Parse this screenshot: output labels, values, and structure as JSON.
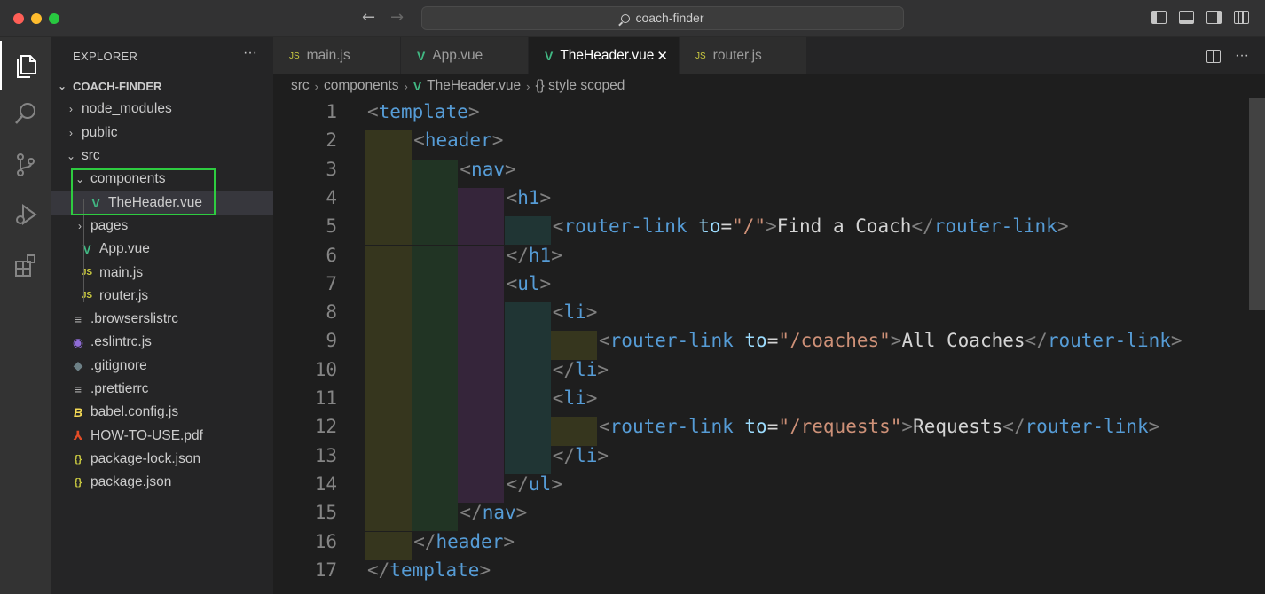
{
  "window": {
    "search_text": "coach-finder"
  },
  "sidebar": {
    "header": "EXPLORER",
    "more": "···",
    "tree": [
      {
        "label": "COACH-FINDER",
        "chevron": "⌄",
        "icon": "",
        "icon_name": "folder-root",
        "indent": 0,
        "root": true
      },
      {
        "label": "node_modules",
        "chevron": "›",
        "icon": "",
        "icon_name": "folder-collapsed",
        "indent": 1
      },
      {
        "label": "public",
        "chevron": "›",
        "icon": "",
        "icon_name": "folder-collapsed",
        "indent": 1
      },
      {
        "label": "src",
        "chevron": "⌄",
        "icon": "",
        "icon_name": "folder-expanded",
        "indent": 1
      },
      {
        "label": "components",
        "chevron": "⌄",
        "icon": "",
        "icon_name": "folder-expanded",
        "indent": 2
      },
      {
        "label": "TheHeader.vue",
        "chevron": "",
        "icon": "V",
        "icon_name": "vue-icon",
        "indent": 3,
        "selected": true
      },
      {
        "label": "pages",
        "chevron": "›",
        "icon": "",
        "icon_name": "folder-collapsed",
        "indent": 2
      },
      {
        "label": "App.vue",
        "chevron": "",
        "icon": "V",
        "icon_name": "vue-icon",
        "indent": 2
      },
      {
        "label": "main.js",
        "chevron": "",
        "icon": "JS",
        "icon_name": "js-icon",
        "indent": 2
      },
      {
        "label": "router.js",
        "chevron": "",
        "icon": "JS",
        "icon_name": "js-icon",
        "indent": 2
      },
      {
        "label": ".browserslistrc",
        "chevron": "",
        "icon": "≡",
        "icon_name": "config-icon",
        "indent": 1
      },
      {
        "label": ".eslintrc.js",
        "chevron": "",
        "icon": "◉",
        "icon_name": "eslint-icon",
        "indent": 1
      },
      {
        "label": ".gitignore",
        "chevron": "",
        "icon": "◆",
        "icon_name": "git-icon",
        "indent": 1
      },
      {
        "label": ".prettierrc",
        "chevron": "",
        "icon": "≡",
        "icon_name": "config-icon",
        "indent": 1
      },
      {
        "label": "babel.config.js",
        "chevron": "",
        "icon": "B",
        "icon_name": "babel-icon",
        "indent": 1
      },
      {
        "label": "HOW-TO-USE.pdf",
        "chevron": "",
        "icon": "⅄",
        "icon_name": "pdf-icon",
        "indent": 1
      },
      {
        "label": "package-lock.json",
        "chevron": "",
        "icon": "{}",
        "icon_name": "json-icon",
        "indent": 1
      },
      {
        "label": "package.json",
        "chevron": "",
        "icon": "{}",
        "icon_name": "json-icon",
        "indent": 1
      }
    ]
  },
  "tabs": [
    {
      "label": "main.js",
      "icon": "JS",
      "active": false
    },
    {
      "label": "App.vue",
      "icon": "V",
      "active": false
    },
    {
      "label": "TheHeader.vue",
      "icon": "V",
      "active": true,
      "close": "✕"
    },
    {
      "label": "router.js",
      "icon": "JS",
      "active": false
    }
  ],
  "breadcrumb": {
    "src": "src",
    "components": "components",
    "file": "TheHeader.vue",
    "section": "{} style scoped",
    "vue_icon": "V",
    "sep": "›"
  },
  "code": {
    "lines": [
      {
        "n": "1",
        "indent": 0,
        "tokens": [
          [
            "punc",
            "<"
          ],
          [
            "tag",
            "template"
          ],
          [
            "punc",
            ">"
          ]
        ]
      },
      {
        "n": "2",
        "indent": 1,
        "tokens": [
          [
            "punc",
            "<"
          ],
          [
            "tag",
            "header"
          ],
          [
            "punc",
            ">"
          ]
        ]
      },
      {
        "n": "3",
        "indent": 2,
        "tokens": [
          [
            "punc",
            "<"
          ],
          [
            "tag",
            "nav"
          ],
          [
            "punc",
            ">"
          ]
        ]
      },
      {
        "n": "4",
        "indent": 3,
        "tokens": [
          [
            "punc",
            "<"
          ],
          [
            "tag",
            "h1"
          ],
          [
            "punc",
            ">"
          ]
        ]
      },
      {
        "n": "5",
        "indent": 4,
        "tokens": [
          [
            "punc",
            "<"
          ],
          [
            "tag",
            "router-link"
          ],
          [
            "text",
            " "
          ],
          [
            "attr",
            "to"
          ],
          [
            "eq",
            "="
          ],
          [
            "str",
            "\"/\""
          ],
          [
            "punc",
            ">"
          ],
          [
            "text",
            "Find a Coach"
          ],
          [
            "punc",
            "</"
          ],
          [
            "tag",
            "router-link"
          ],
          [
            "punc",
            ">"
          ]
        ]
      },
      {
        "n": "6",
        "indent": 3,
        "tokens": [
          [
            "punc",
            "</"
          ],
          [
            "tag",
            "h1"
          ],
          [
            "punc",
            ">"
          ]
        ]
      },
      {
        "n": "7",
        "indent": 3,
        "tokens": [
          [
            "punc",
            "<"
          ],
          [
            "tag",
            "ul"
          ],
          [
            "punc",
            ">"
          ]
        ]
      },
      {
        "n": "8",
        "indent": 4,
        "tokens": [
          [
            "punc",
            "<"
          ],
          [
            "tag",
            "li"
          ],
          [
            "punc",
            ">"
          ]
        ]
      },
      {
        "n": "9",
        "indent": 5,
        "tokens": [
          [
            "punc",
            "<"
          ],
          [
            "tag",
            "router-link"
          ],
          [
            "text",
            " "
          ],
          [
            "attr",
            "to"
          ],
          [
            "eq",
            "="
          ],
          [
            "str",
            "\"/coaches\""
          ],
          [
            "punc",
            ">"
          ],
          [
            "text",
            "All Coaches"
          ],
          [
            "punc",
            "</"
          ],
          [
            "tag",
            "router-link"
          ],
          [
            "punc",
            ">"
          ]
        ]
      },
      {
        "n": "10",
        "indent": 4,
        "tokens": [
          [
            "punc",
            "</"
          ],
          [
            "tag",
            "li"
          ],
          [
            "punc",
            ">"
          ]
        ]
      },
      {
        "n": "11",
        "indent": 4,
        "tokens": [
          [
            "punc",
            "<"
          ],
          [
            "tag",
            "li"
          ],
          [
            "punc",
            ">"
          ]
        ]
      },
      {
        "n": "12",
        "indent": 5,
        "tokens": [
          [
            "punc",
            "<"
          ],
          [
            "tag",
            "router-link"
          ],
          [
            "text",
            " "
          ],
          [
            "attr",
            "to"
          ],
          [
            "eq",
            "="
          ],
          [
            "str",
            "\"/requests\""
          ],
          [
            "punc",
            ">"
          ],
          [
            "text",
            "Requests"
          ],
          [
            "punc",
            "</"
          ],
          [
            "tag",
            "router-link"
          ],
          [
            "punc",
            ">"
          ]
        ]
      },
      {
        "n": "13",
        "indent": 4,
        "tokens": [
          [
            "punc",
            "</"
          ],
          [
            "tag",
            "li"
          ],
          [
            "punc",
            ">"
          ]
        ]
      },
      {
        "n": "14",
        "indent": 3,
        "tokens": [
          [
            "punc",
            "</"
          ],
          [
            "tag",
            "ul"
          ],
          [
            "punc",
            ">"
          ]
        ]
      },
      {
        "n": "15",
        "indent": 2,
        "tokens": [
          [
            "punc",
            "</"
          ],
          [
            "tag",
            "nav"
          ],
          [
            "punc",
            ">"
          ]
        ]
      },
      {
        "n": "16",
        "indent": 1,
        "tokens": [
          [
            "punc",
            "</"
          ],
          [
            "tag",
            "header"
          ],
          [
            "punc",
            ">"
          ]
        ]
      },
      {
        "n": "17",
        "indent": 0,
        "tokens": [
          [
            "punc",
            "</"
          ],
          [
            "tag",
            "template"
          ],
          [
            "punc",
            ">"
          ]
        ]
      }
    ]
  },
  "colors": {
    "indent_guides": [
      "#36361e",
      "#213424",
      "#35253a",
      "#203534",
      "#36361e"
    ],
    "highlight_box": "#2ecc40",
    "vue_green": "#41b883",
    "js_yellow": "#cbcb41"
  }
}
